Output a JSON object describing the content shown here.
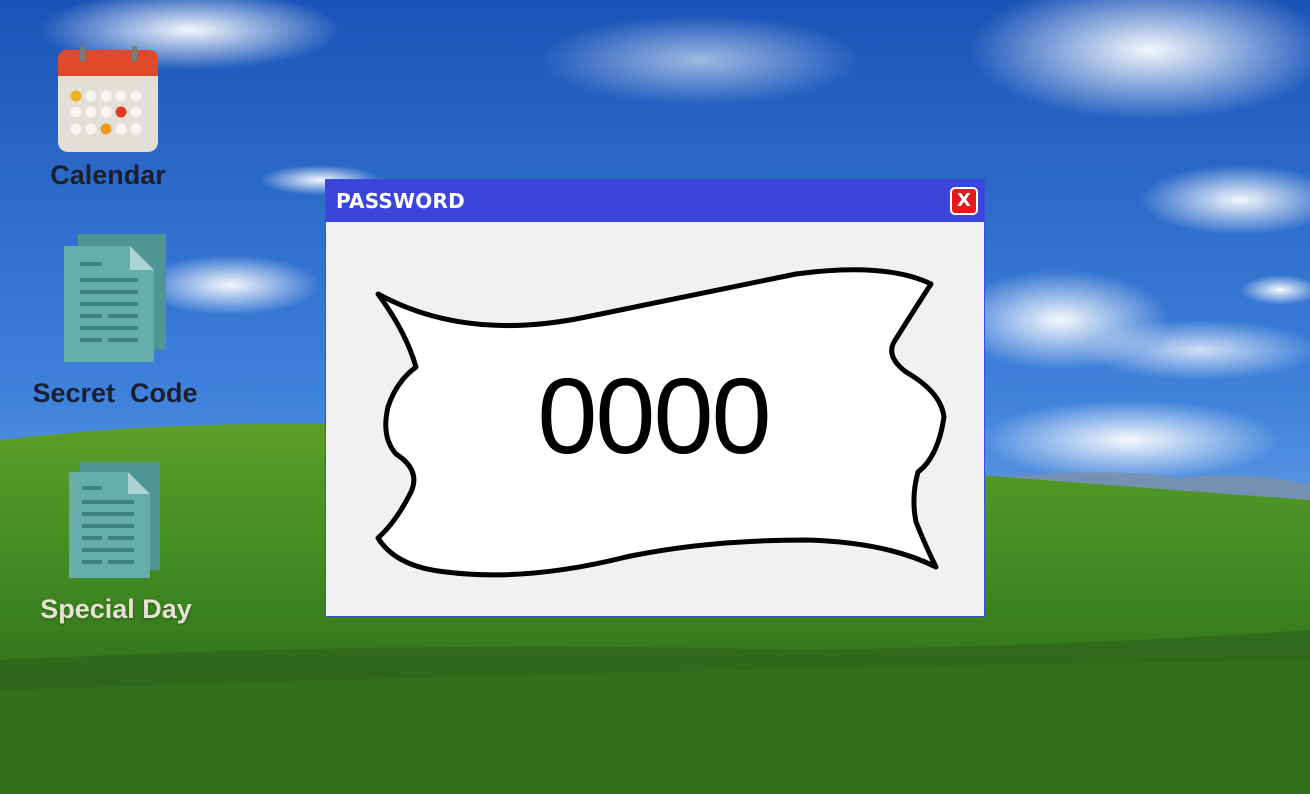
{
  "desktop": {
    "icons": [
      {
        "label": "Calendar",
        "icon": "calendar-icon"
      },
      {
        "label": "Secret  Code",
        "icon": "document-icon"
      },
      {
        "label": "Special Day",
        "icon": "document-icon"
      }
    ]
  },
  "window": {
    "title": "PASSWORD",
    "close_label": "X",
    "code": "0000"
  },
  "colors": {
    "titlebar": "#3b45d9",
    "close": "#e31b1b",
    "doc_icon": "#5fa8a6"
  }
}
